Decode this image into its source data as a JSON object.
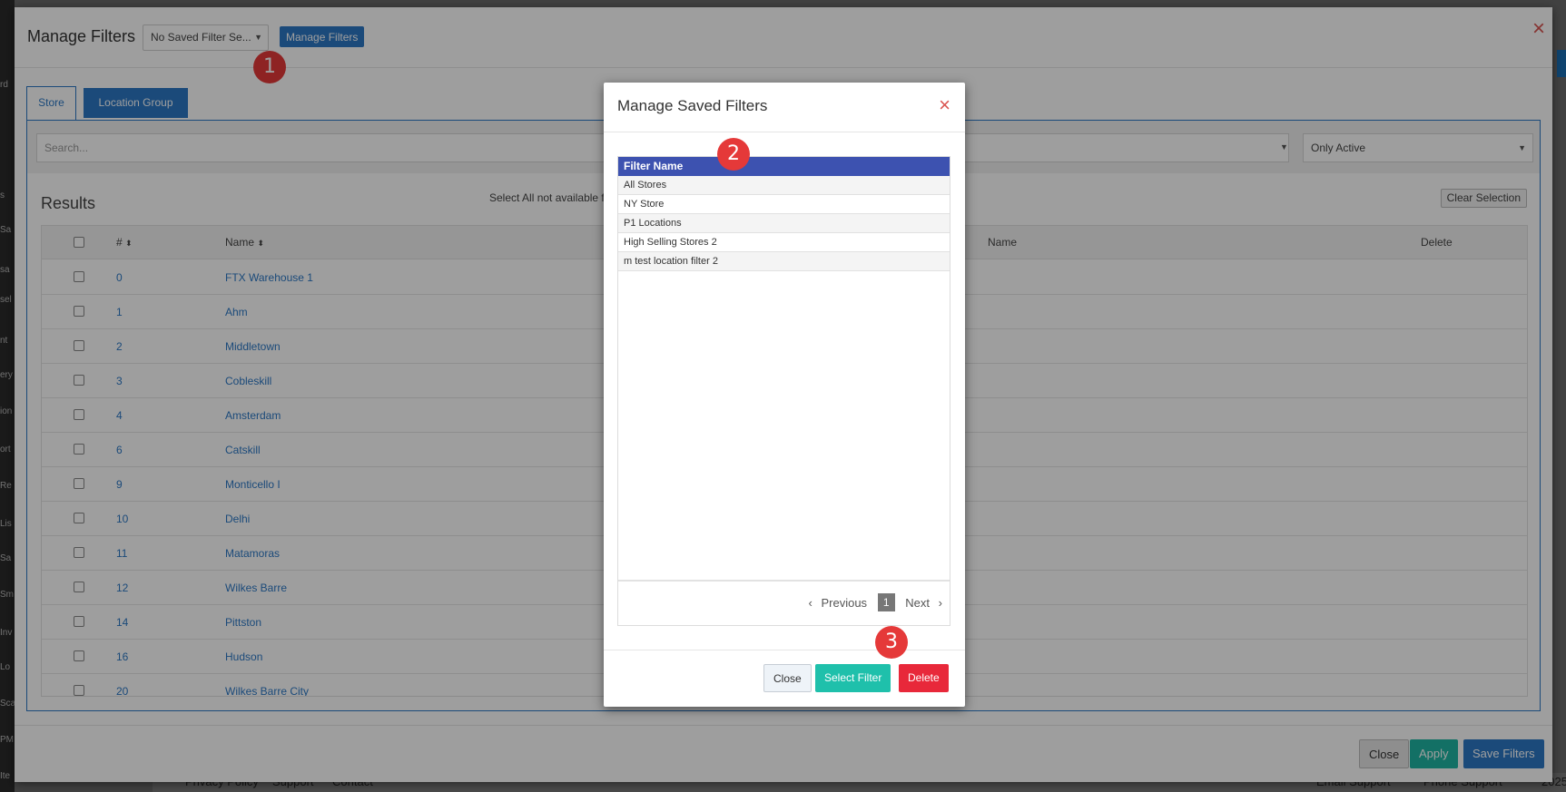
{
  "background": {
    "sidebar_labels": [
      "rd",
      "s",
      "Sa",
      "sa",
      "sel",
      "nt",
      "ery",
      "ion",
      "ort",
      "Re",
      "Lis",
      "Sa",
      "Sm",
      "Inv",
      "Lo",
      "Sca",
      "PM",
      "Ite"
    ],
    "footer_links": [
      "Privacy Policy",
      "Support",
      "Contact"
    ],
    "footer_right": [
      "Email Support",
      "Phone Support",
      "2025"
    ]
  },
  "main_modal": {
    "title": "Manage Filters",
    "saved_filter_select": "No Saved Filter Se...",
    "manage_button": "Manage Filters",
    "close_icon": "×",
    "tabs": [
      {
        "label": "Store"
      },
      {
        "label": "Location Group"
      }
    ],
    "search_placeholder": "Search...",
    "status_select": "Only Active",
    "results_title": "Results",
    "select_note": "Select All not available for m",
    "clear_selection": "Clear Selection",
    "columns": [
      "#",
      "Name",
      "Name",
      "Delete"
    ],
    "rows": [
      {
        "num": "0",
        "name": "FTX Warehouse 1"
      },
      {
        "num": "1",
        "name": "Ahm"
      },
      {
        "num": "2",
        "name": "Middletown"
      },
      {
        "num": "3",
        "name": "Cobleskill"
      },
      {
        "num": "4",
        "name": "Amsterdam"
      },
      {
        "num": "6",
        "name": "Catskill"
      },
      {
        "num": "9",
        "name": "Monticello I"
      },
      {
        "num": "10",
        "name": "Delhi"
      },
      {
        "num": "11",
        "name": "Matamoras"
      },
      {
        "num": "12",
        "name": "Wilkes Barre"
      },
      {
        "num": "14",
        "name": "Pittston"
      },
      {
        "num": "16",
        "name": "Hudson"
      },
      {
        "num": "20",
        "name": "Wilkes Barre City"
      }
    ],
    "footer": {
      "close": "Close",
      "apply": "Apply",
      "save": "Save Filters"
    }
  },
  "saved_modal": {
    "title": "Manage Saved Filters",
    "close_icon": "×",
    "column_header": "Filter Name",
    "filters": [
      "All Stores",
      "NY Store",
      "P1 Locations",
      "High Selling Stores 2",
      "m test location filter 2"
    ],
    "pager": {
      "previous": "Previous",
      "page": "1",
      "next": "Next"
    },
    "buttons": {
      "close": "Close",
      "select": "Select Filter",
      "delete": "Delete"
    }
  },
  "badges": [
    "1",
    "2",
    "3"
  ]
}
